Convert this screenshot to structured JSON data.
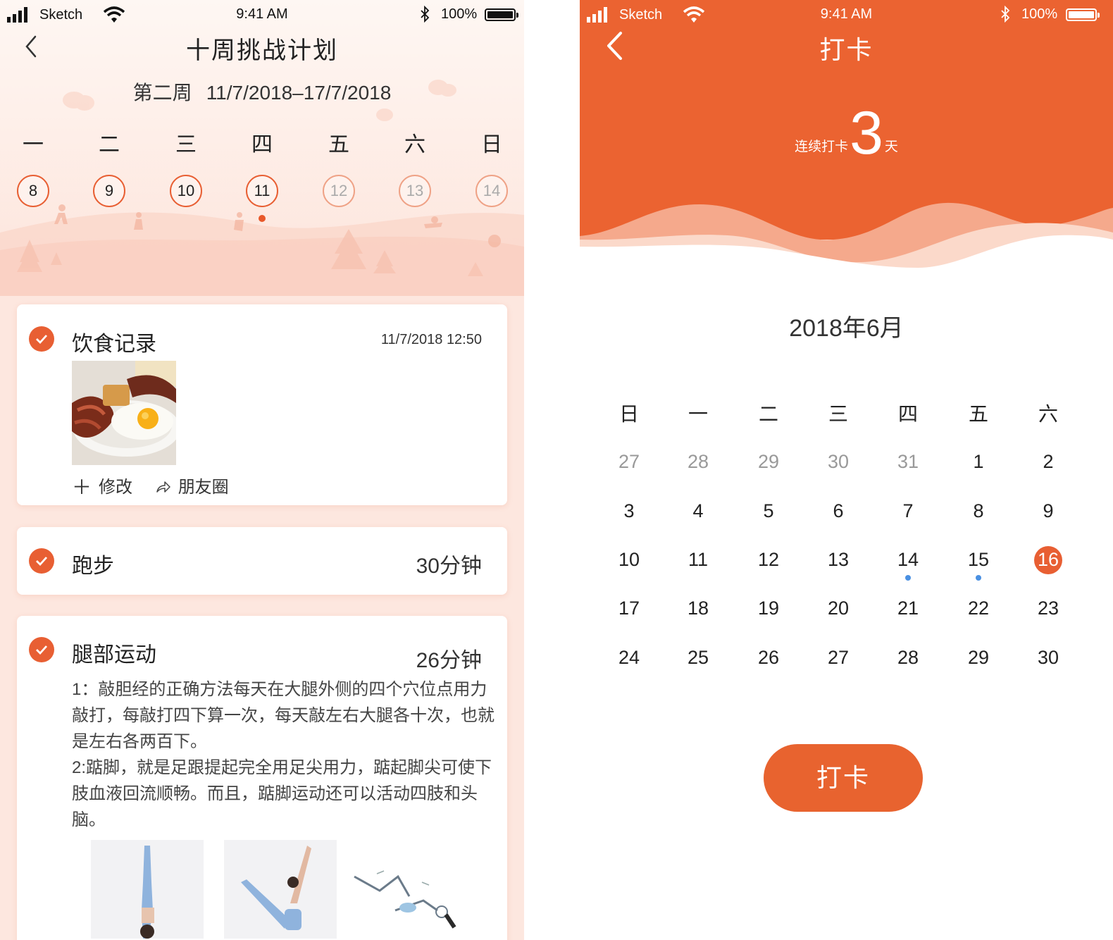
{
  "status_bar": {
    "carrier": "Sketch",
    "time": "9:41 AM",
    "battery": "100%"
  },
  "plan": {
    "title": "十周挑战计划",
    "week_name": "第二周",
    "week_range": "11/7/2018–17/7/2018",
    "weekdays": [
      "一",
      "二",
      "三",
      "四",
      "五",
      "六",
      "日"
    ],
    "days": [
      "8",
      "9",
      "10",
      "11",
      "12",
      "13",
      "14"
    ],
    "today_index": 3
  },
  "diet_card": {
    "title": "饮食记录",
    "timestamp": "11/7/2018 12:50",
    "edit_label": "修改",
    "share_label": "朋友圈"
  },
  "running_card": {
    "title": "跑步",
    "duration": "30分钟"
  },
  "leg_card": {
    "title": "腿部运动",
    "duration": "26分钟",
    "description": "1：敲胆经的正确方法每天在大腿外侧的四个穴位点用力敲打，每敲打四下算一次，每天敲左右大腿各十次，也就是左右各两百下。\n2:踮脚，就是足跟提起完全用足尖用力，踮起脚尖可使下肢血液回流顺畅。而且，踮脚运动还可以活动四肢和头脑。"
  },
  "checkin": {
    "title": "打卡",
    "streak_prefix": "连续打卡",
    "streak_count": "3",
    "streak_suffix": "天",
    "month_title": "2018年6月",
    "weekdays": [
      "日",
      "一",
      "二",
      "三",
      "四",
      "五",
      "六"
    ],
    "weeks": [
      [
        "27",
        "28",
        "29",
        "30",
        "31",
        "1",
        "2"
      ],
      [
        "3",
        "4",
        "5",
        "6",
        "7",
        "8",
        "9"
      ],
      [
        "10",
        "11",
        "12",
        "13",
        "14",
        "15",
        "16"
      ],
      [
        "17",
        "18",
        "19",
        "20",
        "21",
        "22",
        "23"
      ],
      [
        "24",
        "25",
        "26",
        "27",
        "28",
        "29",
        "30"
      ]
    ],
    "muted_days_first_row": 5,
    "selected_day": "16",
    "dotted_days": [
      "14",
      "15"
    ],
    "button_label": "打卡"
  },
  "colors": {
    "accent": "#e85f33",
    "dot": "#4a90e2",
    "left_bg": "#fde7df"
  }
}
